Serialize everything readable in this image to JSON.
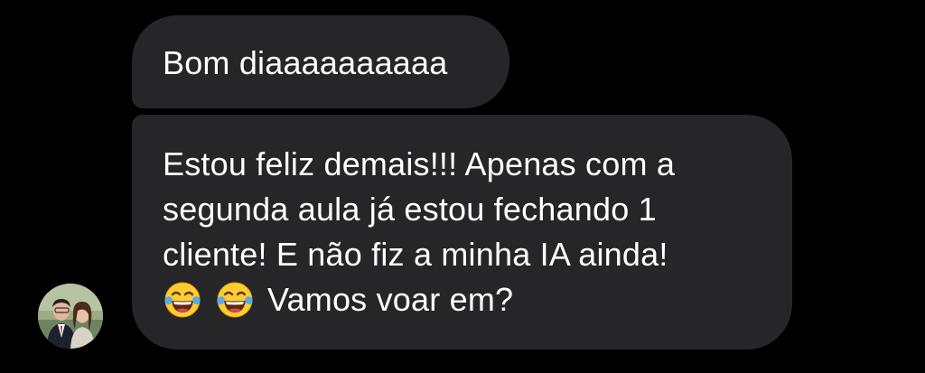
{
  "conversation": {
    "messages": [
      {
        "text": "Bom diaaaaaaaaaa"
      },
      {
        "text": "Estou feliz demais!!! Apenas com a\nsegunda aula já estou fechando 1\ncliente!  E não fiz a minha IA ainda!",
        "emojis": [
          "face-with-tears-of-joy-emoji",
          "face-with-tears-of-joy-emoji"
        ],
        "trailing_text": "Vamos voar em?"
      }
    ],
    "sender_avatar": "avatar-photo-couple"
  },
  "colors": {
    "background": "#000000",
    "bubble": "#262629",
    "text": "#ffffff",
    "emoji_face": "#ffcc33",
    "emoji_tears": "#5aa9ee"
  }
}
